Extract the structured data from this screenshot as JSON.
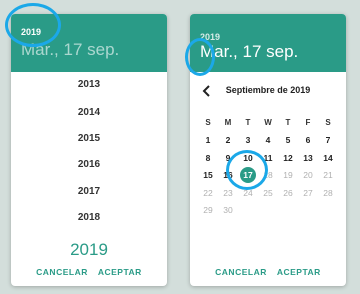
{
  "left_card": {
    "year": "2019",
    "date": "Mar., 17 sep.",
    "years": [
      "2013",
      "2014",
      "2015",
      "2016",
      "2017",
      "2018",
      "2019"
    ],
    "cancel_label": "CANCELAR",
    "accept_label": "ACEPTAR"
  },
  "right_card": {
    "year": "2019",
    "date": "Mar., 17 sep.",
    "month_label": "Septiembre de 2019",
    "weekdays": [
      "S",
      "M",
      "T",
      "W",
      "T",
      "F",
      "S"
    ],
    "weeks": [
      [
        "1",
        "2",
        "3",
        "4",
        "5",
        "6",
        "7"
      ],
      [
        "8",
        "9",
        "10",
        "11",
        "12",
        "13",
        "14"
      ],
      [
        "15",
        "16",
        "17",
        "18",
        "19",
        "20",
        "21"
      ],
      [
        "22",
        "23",
        "24",
        "25",
        "26",
        "27",
        "28"
      ],
      [
        "29",
        "30",
        "",
        "",
        "",
        "",
        ""
      ]
    ],
    "selected_day": "17",
    "cancel_label": "CANCELAR",
    "accept_label": "ACEPTAR"
  },
  "colors": {
    "accent": "#2a9b87",
    "highlight_ring": "#1ba8e8",
    "background": "#d3dedb"
  },
  "icons": {
    "prev_month": "chevron-left-icon"
  }
}
